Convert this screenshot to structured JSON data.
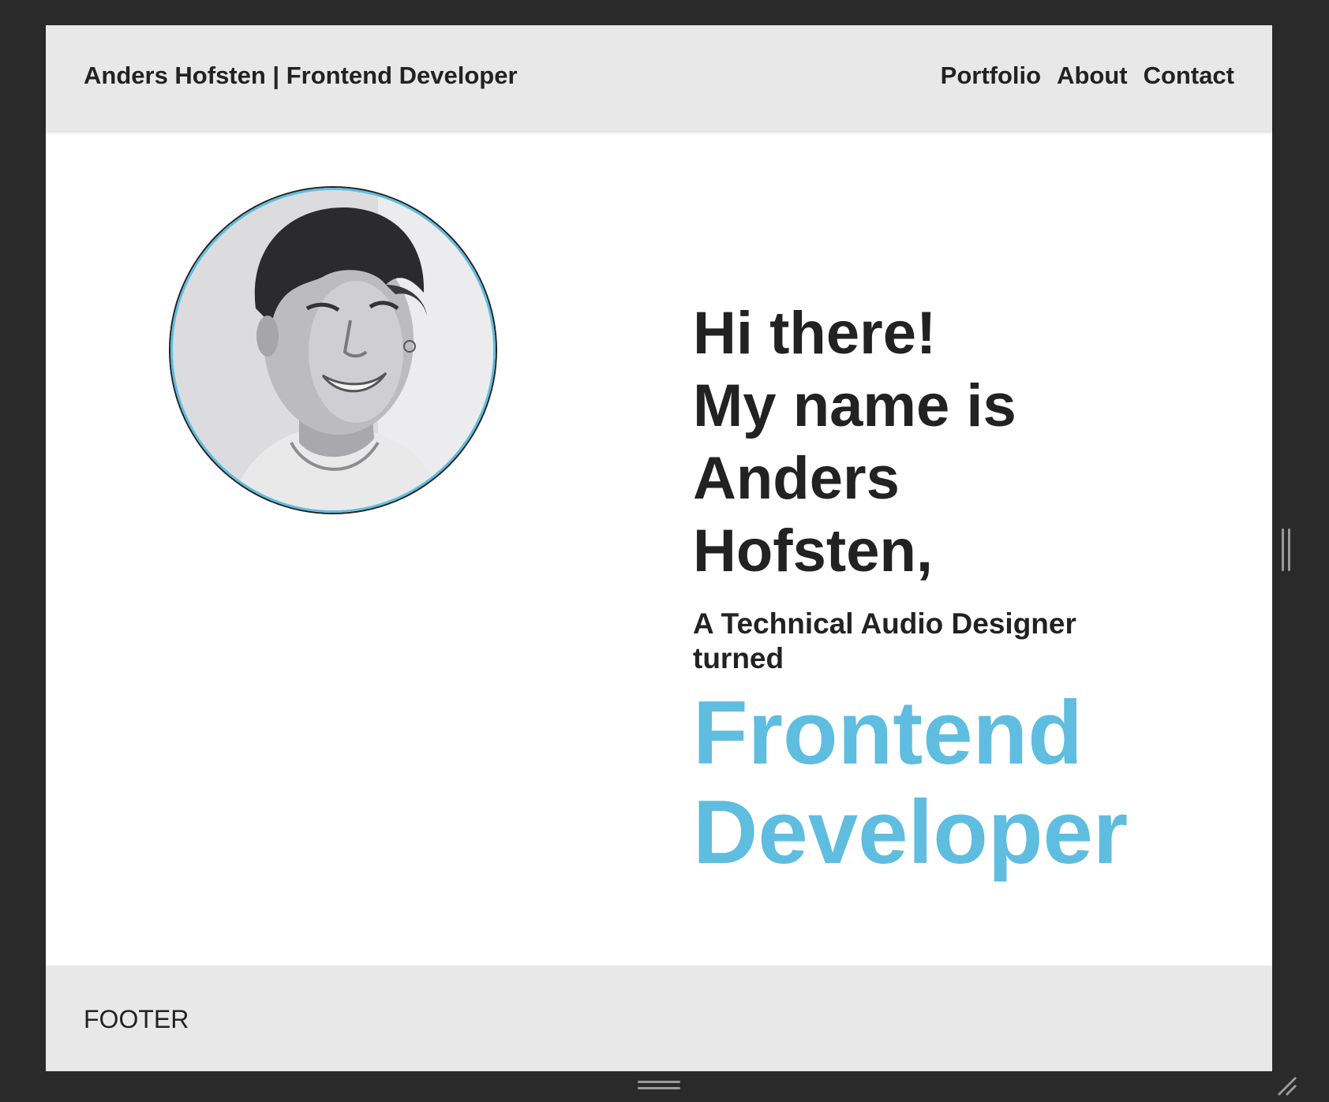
{
  "header": {
    "brand": "Anders Hofsten | Frontend Developer",
    "nav": [
      "Portfolio",
      "About",
      "Contact"
    ]
  },
  "hero": {
    "greeting_lines": [
      "Hi there!",
      "My name is",
      "Anders",
      "Hofsten,"
    ],
    "subtitle_lines": [
      "A Technical Audio Designer",
      "turned"
    ],
    "role_lines": [
      "Frontend",
      "Developer"
    ],
    "avatar_icon": "portrait-photo"
  },
  "footer": {
    "text": "FOOTER"
  },
  "colors": {
    "accent": "#5fbde0",
    "text": "#222222",
    "bar": "#e8e8e9",
    "backdrop": "#2a2a2b"
  }
}
